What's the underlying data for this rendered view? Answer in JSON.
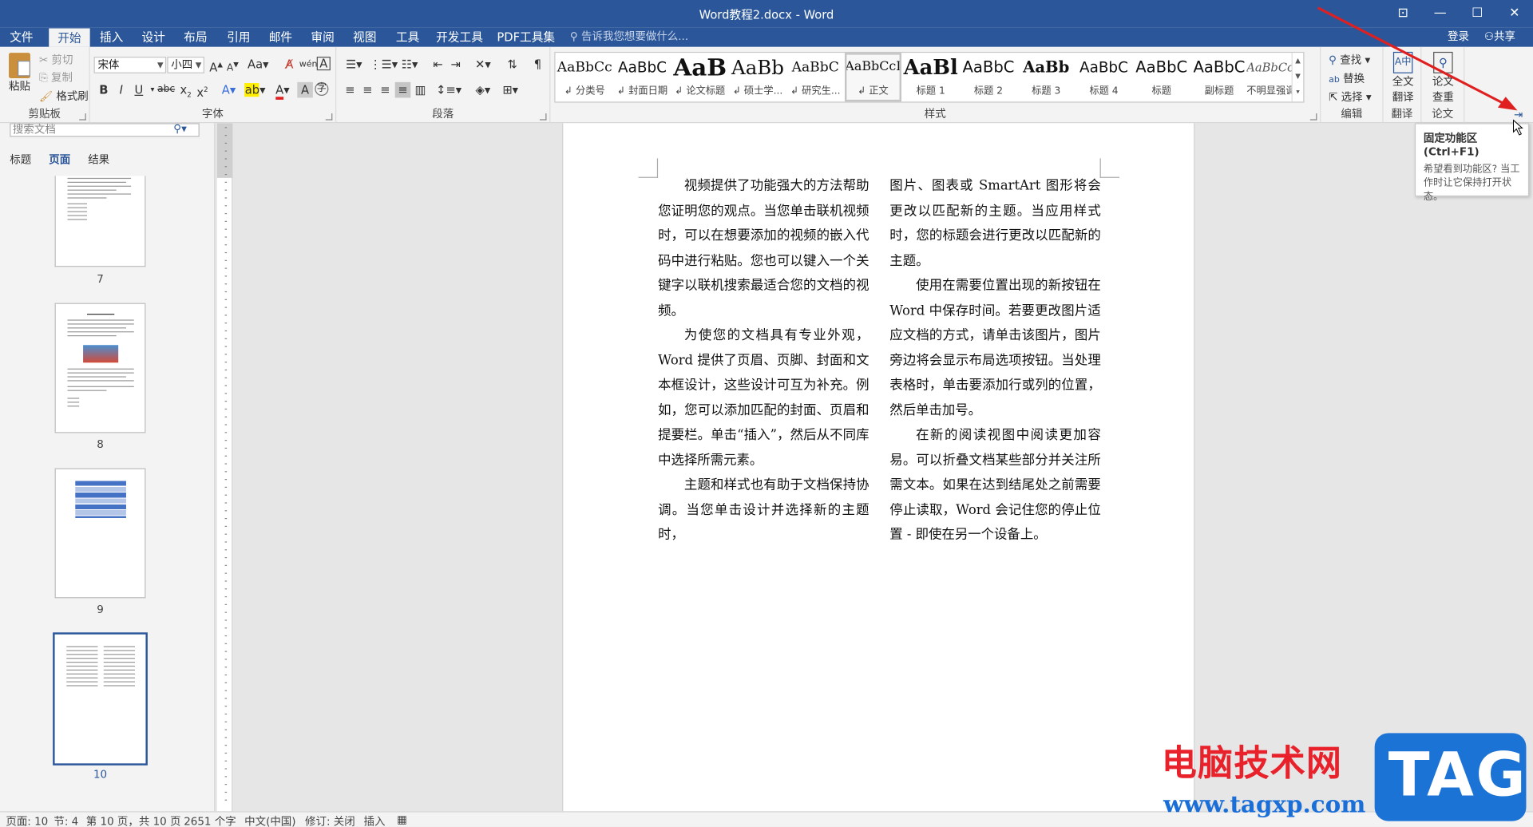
{
  "titlebar": {
    "title": "Word教程2.docx - Word",
    "ribbon_options": "⊡",
    "minimize": "—",
    "maximize": "☐",
    "close": "✕"
  },
  "tabs": [
    "文件",
    "开始",
    "插入",
    "设计",
    "布局",
    "引用",
    "邮件",
    "审阅",
    "视图",
    "工具",
    "开发工具",
    "PDF工具集"
  ],
  "active_tab": "开始",
  "tellme": "告诉我您想要做什么...",
  "account": {
    "login": "登录",
    "share": "共享"
  },
  "clipboard": {
    "paste": "粘贴",
    "cut": "剪切",
    "copy": "复制",
    "format_painter": "格式刷",
    "label": "剪贴板"
  },
  "font": {
    "name": "宋体",
    "size": "小四",
    "label": "字体"
  },
  "paragraph": {
    "label": "段落"
  },
  "styles": {
    "label": "样式",
    "items": [
      {
        "preview": "AaBbCc",
        "name": "↲ 分类号"
      },
      {
        "preview": "AaBbC",
        "name": "↲ 封面日期"
      },
      {
        "preview": "AaB",
        "name": "↲ 论文标题"
      },
      {
        "preview": "AaBb",
        "name": "↲ 硕士学..."
      },
      {
        "preview": "AaBbC",
        "name": "↲ 研究生..."
      },
      {
        "preview": "AaBbCcI",
        "name": "↲ 正文"
      },
      {
        "preview": "AaBl",
        "name": "标题 1"
      },
      {
        "preview": "AaBbC",
        "name": "标题 2"
      },
      {
        "preview": "AaBb",
        "name": "标题 3"
      },
      {
        "preview": "AaBbC",
        "name": "标题 4"
      },
      {
        "preview": "AaBbC",
        "name": "标题"
      },
      {
        "preview": "AaBbC",
        "name": "副标题"
      },
      {
        "preview": "AaBbCcI",
        "name": "不明显强调"
      }
    ]
  },
  "editing": {
    "find": "查找",
    "replace": "替换",
    "select": "选择",
    "label": "编辑"
  },
  "translate": {
    "full": "全文",
    "full2": "翻译",
    "label": "翻译"
  },
  "paper": {
    "check": "论文",
    "check2": "查重",
    "label": "论文"
  },
  "nav": {
    "search_placeholder": "搜索文档",
    "tabs": [
      "标题",
      "页面",
      "结果"
    ],
    "active": "页面",
    "pages": [
      "7",
      "8",
      "9",
      "10"
    ]
  },
  "document": {
    "col1": [
      "视频提供了功能强大的方法帮助您证明您的观点。当您单击联机视频时，可以在想要添加的视频的嵌入代码中进行粘贴。您也可以键入一个关键字以联机搜索最适合您的文档的视频。",
      "为使您的文档具有专业外观，Word 提供了页眉、页脚、封面和文本框设计，这些设计可互为补充。例如，您可以添加匹配的封面、页眉和提要栏。单击“插入”，然后从不同库中选择所需元素。",
      "主题和样式也有助于文档保持协调。当您单击设计并选择新的主题时，"
    ],
    "col2": [
      "图片、图表或 SmartArt 图形将会更改以匹配新的主题。当应用样式时，您的标题会进行更改以匹配新的主题。",
      "使用在需要位置出现的新按钮在 Word 中保存时间。若要更改图片适应文档的方式，请单击该图片，图片旁边将会显示布局选项按钮。当处理表格时，单击要添加行或列的位置，然后单击加号。",
      "在新的阅读视图中阅读更加容易。可以折叠文档某些部分并关注所需文本。如果在达到结尾处之前需要停止读取，Word 会记住您的停止位置 - 即使在另一个设备上。"
    ]
  },
  "tooltip": {
    "title": "固定功能区(Ctrl+F1)",
    "body": "希望看到功能区? 当工作时让它保持打开状态。"
  },
  "status": {
    "page": "页面: 10",
    "section": "节: 4",
    "pages": "第 10 页，共 10 页",
    "words": "2651 个字",
    "lang": "中文(中国)",
    "revise": "修订: 关闭",
    "insert": "插入"
  },
  "watermark": {
    "text": "电脑技术网",
    "url": "www.tagxp.com",
    "tag": "TAG"
  },
  "colors": {
    "word_blue": "#2b579a",
    "arrow": "#e02020"
  }
}
